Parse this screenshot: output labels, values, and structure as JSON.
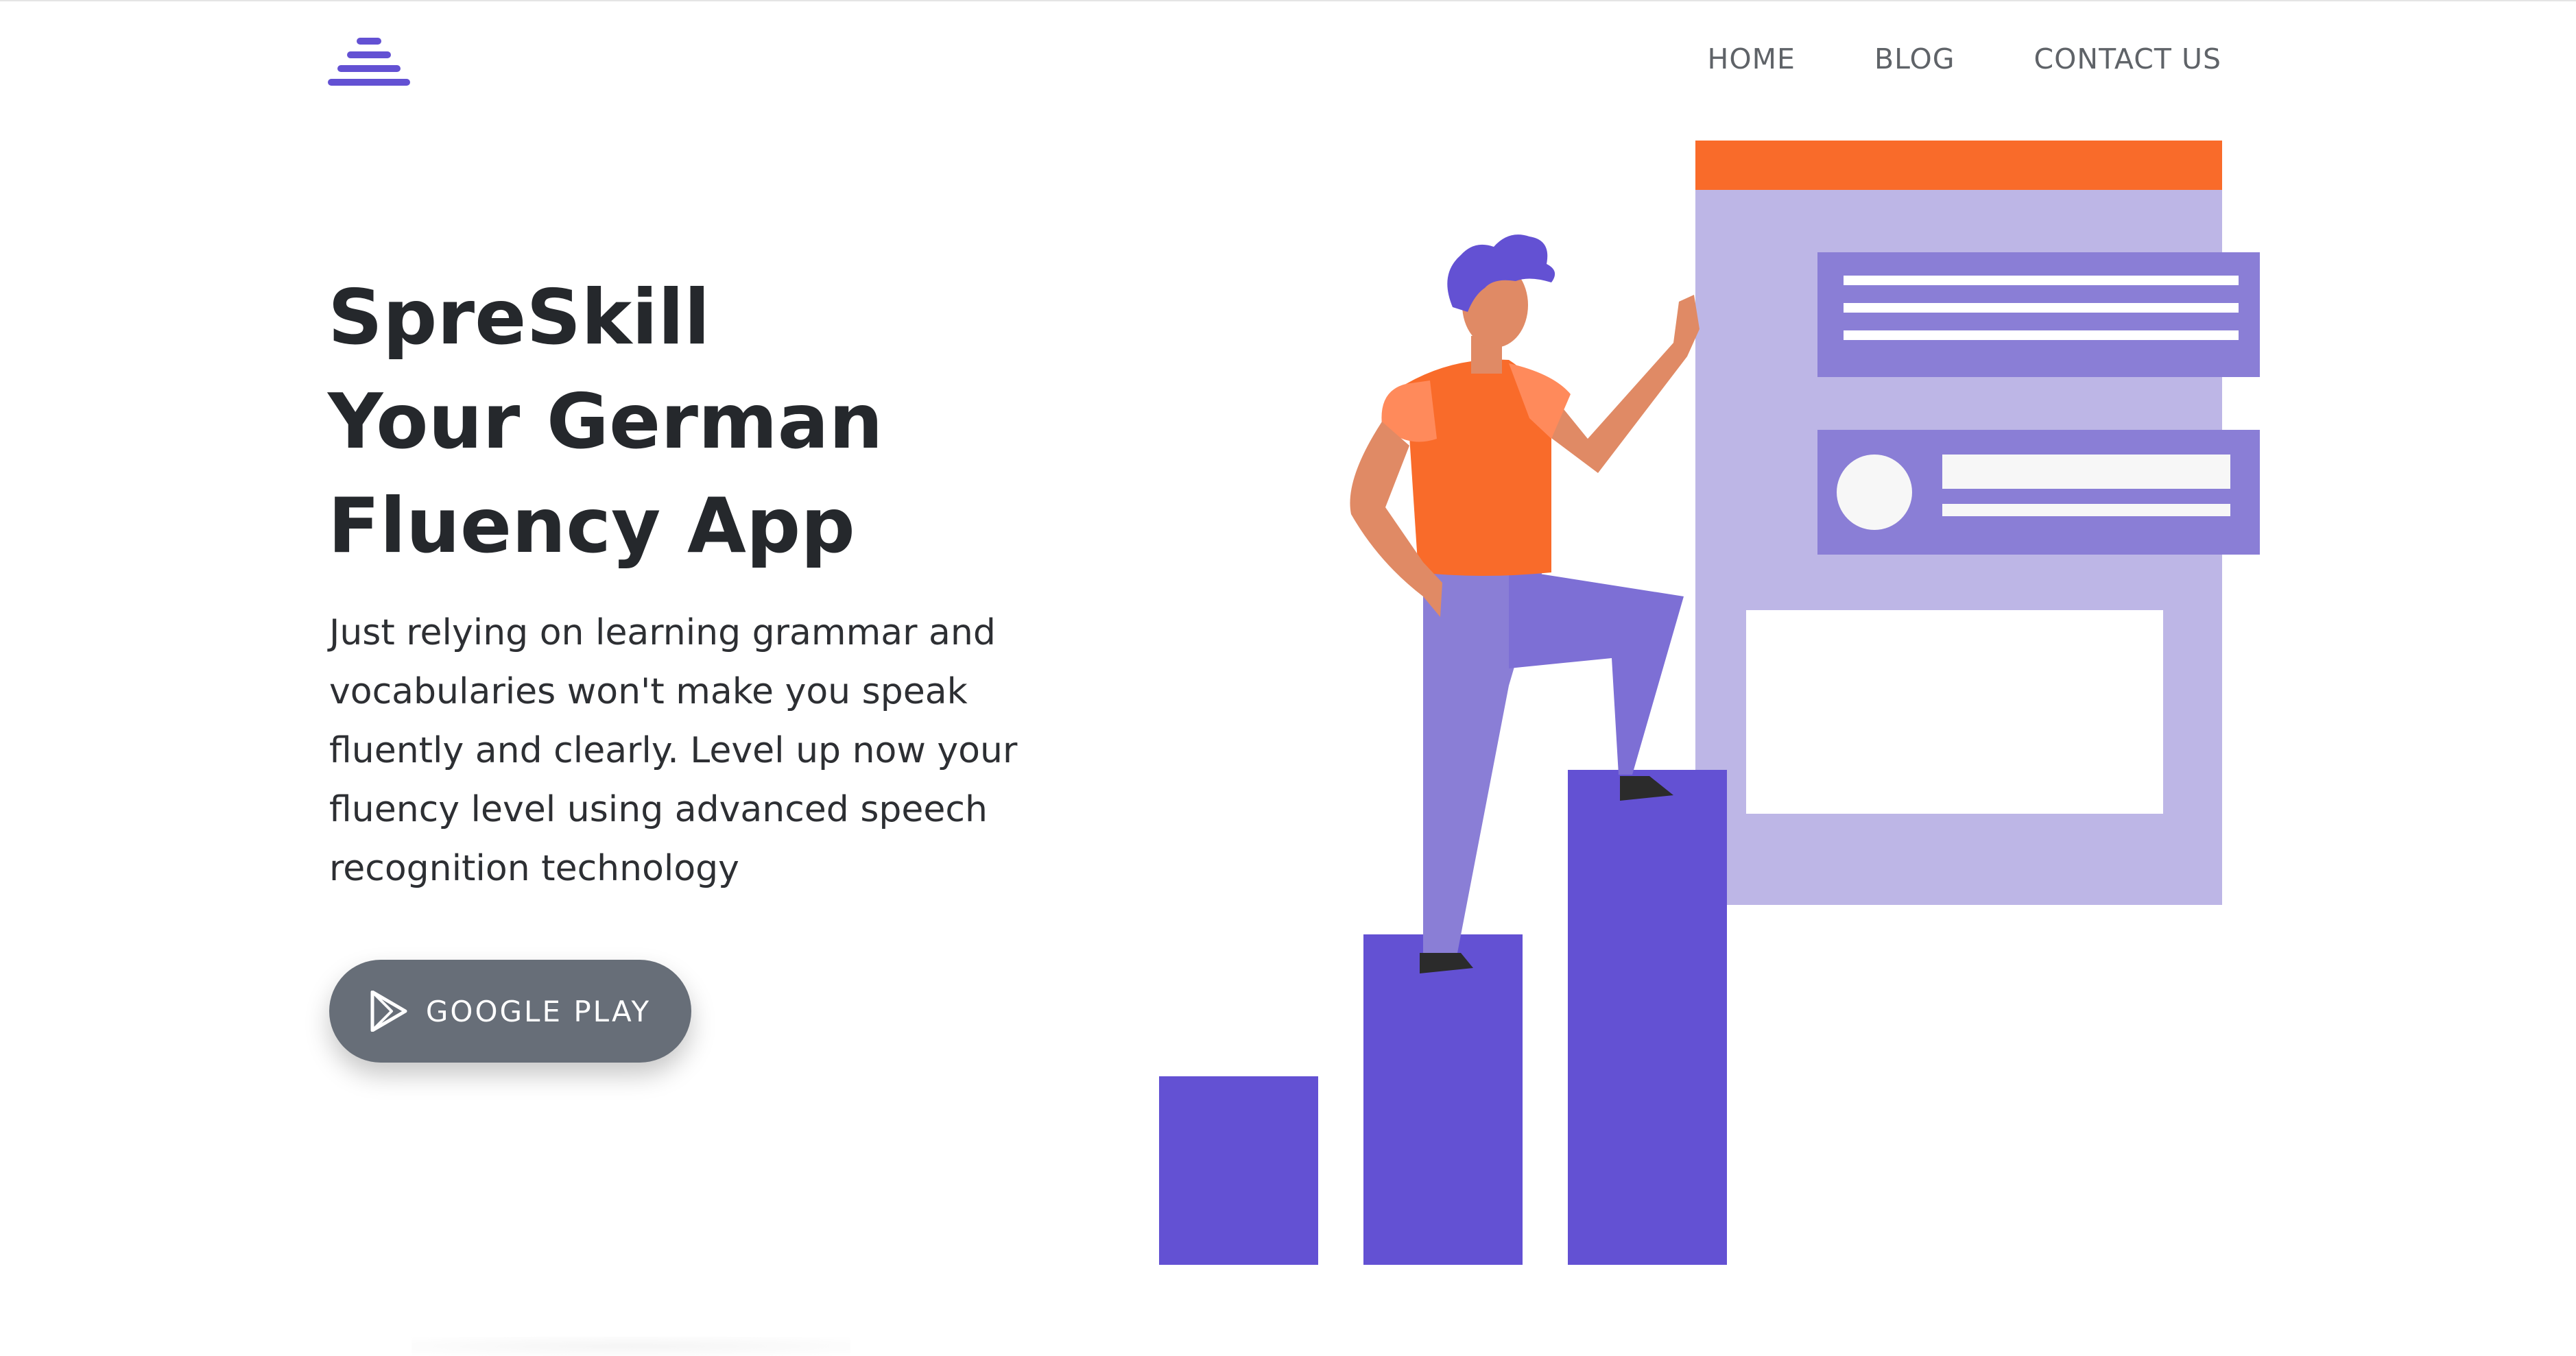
{
  "nav": {
    "home": "HOME",
    "blog": "BLOG",
    "contact": "CONTACT US"
  },
  "hero": {
    "title_line1": "SpreSkill",
    "title_line2": "Your German",
    "title_line3": "Fluency App",
    "description": "Just relying on learning grammar and vocabularies won't make you speak fluently and clearly. Level up now your fluency level using advanced speech recognition technology"
  },
  "cta": {
    "label": "GOOGLE PLAY",
    "icon": "play-store-icon"
  },
  "logo": {
    "icon": "stacked-bars-logo-icon"
  },
  "colors": {
    "brand_purple": "#6351d3",
    "lavender": "#bdb6e6",
    "accent_orange": "#f96b2a",
    "button_gray": "#676e78"
  }
}
